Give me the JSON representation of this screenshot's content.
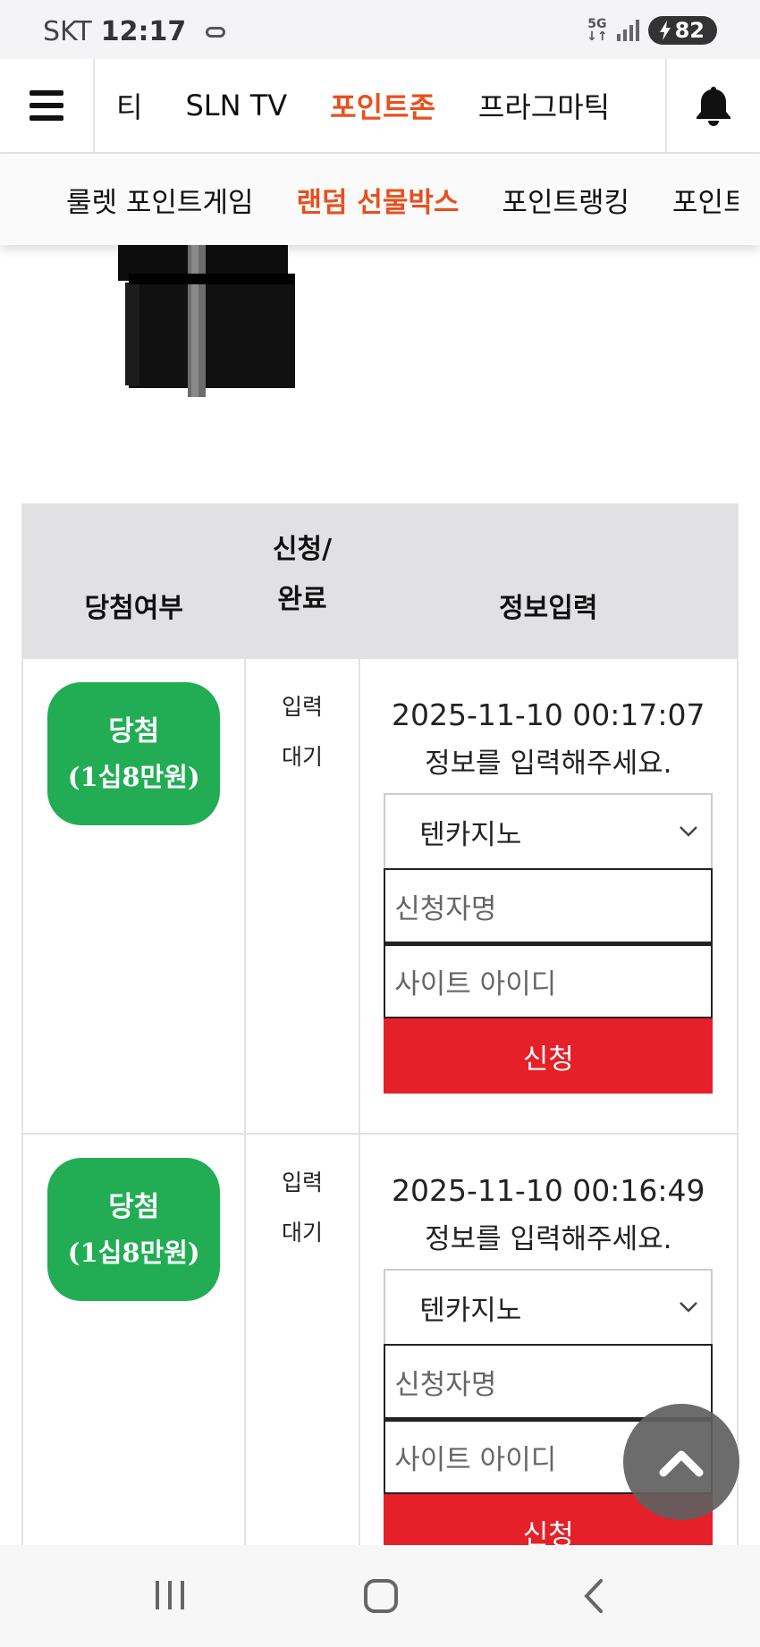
{
  "status_bar": {
    "carrier": "SKT",
    "time": "12:17",
    "network": "5G",
    "battery": "82"
  },
  "top_nav": {
    "items": [
      {
        "label": "티",
        "active": false
      },
      {
        "label": "SLN TV",
        "active": false
      },
      {
        "label": "포인트존",
        "active": true
      },
      {
        "label": "프라그마틱",
        "active": false
      }
    ],
    "icons": [
      "menu-icon",
      "bell-icon"
    ]
  },
  "sub_nav": {
    "items": [
      {
        "label": "룰렛 포인트게임",
        "active": false
      },
      {
        "label": "랜덤 선물박스",
        "active": true
      },
      {
        "label": "포인트랭킹",
        "active": false
      },
      {
        "label": "포인트",
        "active": false
      }
    ]
  },
  "table": {
    "headers": {
      "result": "당첨여부",
      "status_line1": "신청/",
      "status_line2": "완료",
      "info": "정보입력"
    },
    "rows": [
      {
        "badge_line1": "당첨",
        "badge_line2": "(1십8만원)",
        "status_line1": "입력",
        "status_line2": "대기",
        "date": "2025-11-10 00:17:07",
        "message": "정보를 입력해주세요.",
        "site_select": "텐카지노",
        "name_placeholder": "신청자명",
        "id_placeholder": "사이트 아이디",
        "apply_label": "신청"
      },
      {
        "badge_line1": "당첨",
        "badge_line2": "(1십8만원)",
        "status_line1": "입력",
        "status_line2": "대기",
        "date": "2025-11-10 00:16:49",
        "message": "정보를 입력해주세요.",
        "site_select": "텐카지노",
        "name_placeholder": "신청자명",
        "id_placeholder": "사이트 아이디",
        "apply_label": "신청"
      }
    ]
  },
  "colors": {
    "accent": "#e8501e",
    "win_badge": "#22ad55",
    "apply_button": "#e52028",
    "header_bg": "#e1e1e4"
  },
  "fab": {
    "icon": "chevron-up-icon"
  },
  "system_nav": {
    "icons": [
      "recent-apps-icon",
      "home-icon",
      "back-icon"
    ]
  }
}
